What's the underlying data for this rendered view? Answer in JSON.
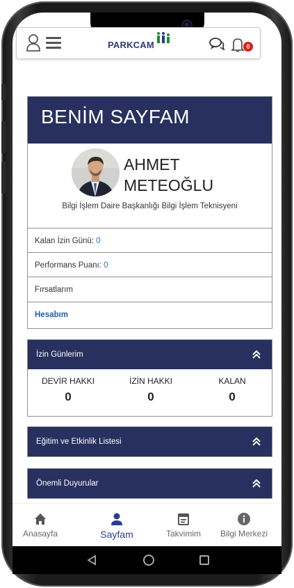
{
  "app": {
    "brand": "PARKCAM"
  },
  "header": {
    "notification_count": "0"
  },
  "profile": {
    "page_title": "BENİM SAYFAM",
    "name_line1": "AHMET",
    "name_line2": "METEOĞLU",
    "job_title": "Bilgi İşlem Daire Başkanlığı Bilgi İşlem Teknisyeni",
    "rows": {
      "leave_label": "Kalan İzin Günü:",
      "leave_value": "0",
      "performance_label": "Performans Puanı:",
      "performance_value": "0",
      "opportunities_label": "Fırsatlarım",
      "account_label": "Hesabım"
    }
  },
  "leave_section": {
    "title": "İzin Günlerim",
    "stats": [
      {
        "label": "DEVİR HAKKI",
        "value": "0"
      },
      {
        "label": "İZİN HAKKI",
        "value": "0"
      },
      {
        "label": "KALAN",
        "value": "0"
      }
    ]
  },
  "training_section": {
    "title": "Eğitim ve Etkinlik Listesi"
  },
  "announcements_section": {
    "title": "Önemli Duyurular"
  },
  "bottom_nav": {
    "items": [
      {
        "label": "Anasayfa",
        "icon": "home-icon"
      },
      {
        "label": "Sayfam",
        "icon": "person-icon"
      },
      {
        "label": "Takvimim",
        "icon": "calendar-icon"
      },
      {
        "label": "Bilgi Merkezi",
        "icon": "info-icon"
      }
    ],
    "active": "Sayfam"
  },
  "colors": {
    "panel_header": "#27305e",
    "link_blue": "#1d5eb5",
    "badge_red": "#e21b1b",
    "nav_active": "#2b3c97"
  }
}
